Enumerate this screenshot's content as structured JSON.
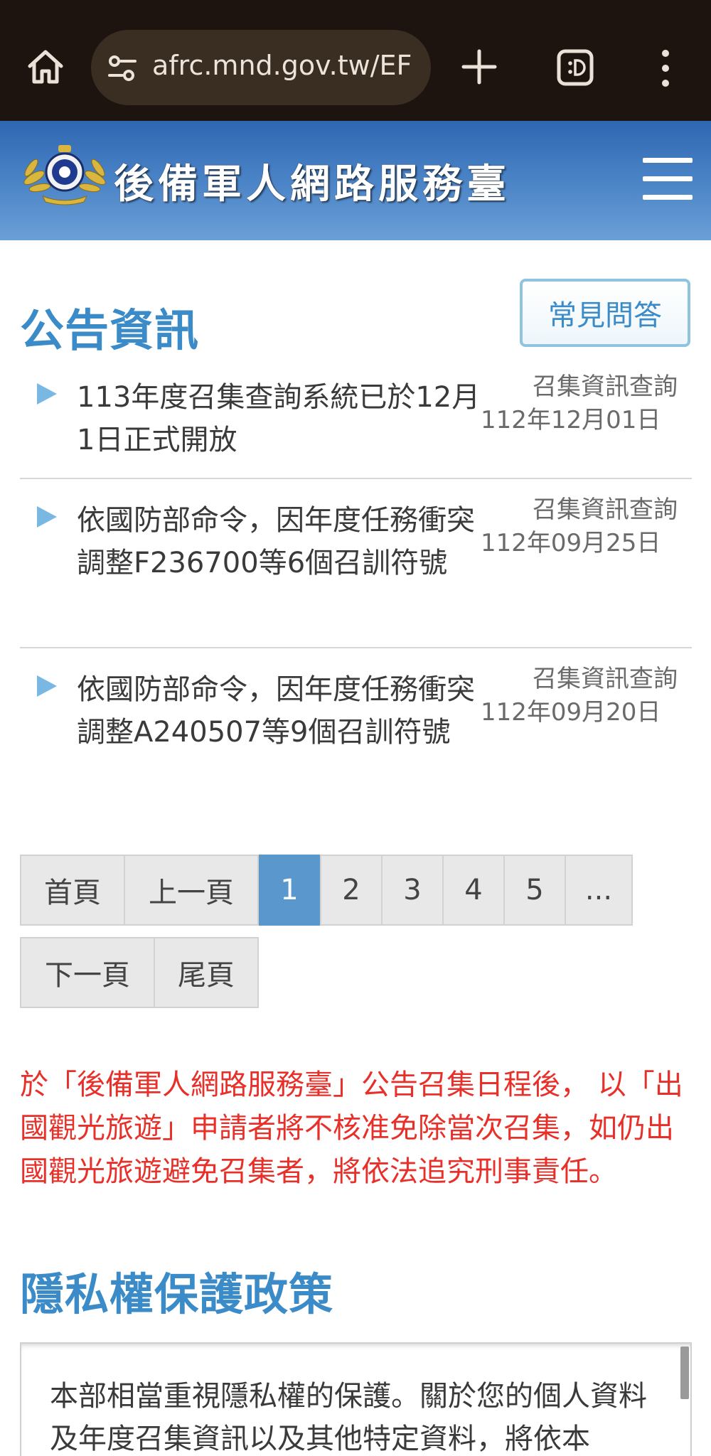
{
  "browser": {
    "url": "afrc.mnd.gov.tw/EF"
  },
  "site": {
    "title": "後備軍人網路服務臺"
  },
  "announcements": {
    "heading": "公告資訊",
    "faq_label": "常見問答",
    "items": [
      {
        "title": "113年度召集查詢系統已於12月1日正式開放",
        "category": "召集資訊查詢",
        "date": "112年12月01日"
      },
      {
        "title": "依國防部命令，因年度任務衝突調整F236700等6個召訓符號",
        "category": "召集資訊查詢",
        "date": "112年09月25日"
      },
      {
        "title": "依國防部命令，因年度任務衝突調整A240507等9個召訓符號",
        "category": "召集資訊查詢",
        "date": "112年09月20日"
      }
    ]
  },
  "pagination": {
    "first": "首頁",
    "prev": "上一頁",
    "pages": [
      "1",
      "2",
      "3",
      "4",
      "5",
      "..."
    ],
    "current": "1",
    "next": "下一頁",
    "last": "尾頁"
  },
  "notice": "於「後備軍人網路服務臺」公告召集日程後， 以「出國觀光旅遊」申請者將不核准免除當次召集，如仍出國觀光旅遊避免召集者，將依法追究刑事責任。",
  "privacy": {
    "heading": "隱私權保護政策",
    "text": "本部相當重視隱私權的保護。關於您的個人資料及年度召集資訊以及其他特定資料，將依本"
  },
  "colors": {
    "chrome_bg": "#1e140f",
    "header_blue": "#4d86c8",
    "heading_blue": "#3a8bc8",
    "active_page": "#5a97cc",
    "notice_red": "#e8302a"
  }
}
